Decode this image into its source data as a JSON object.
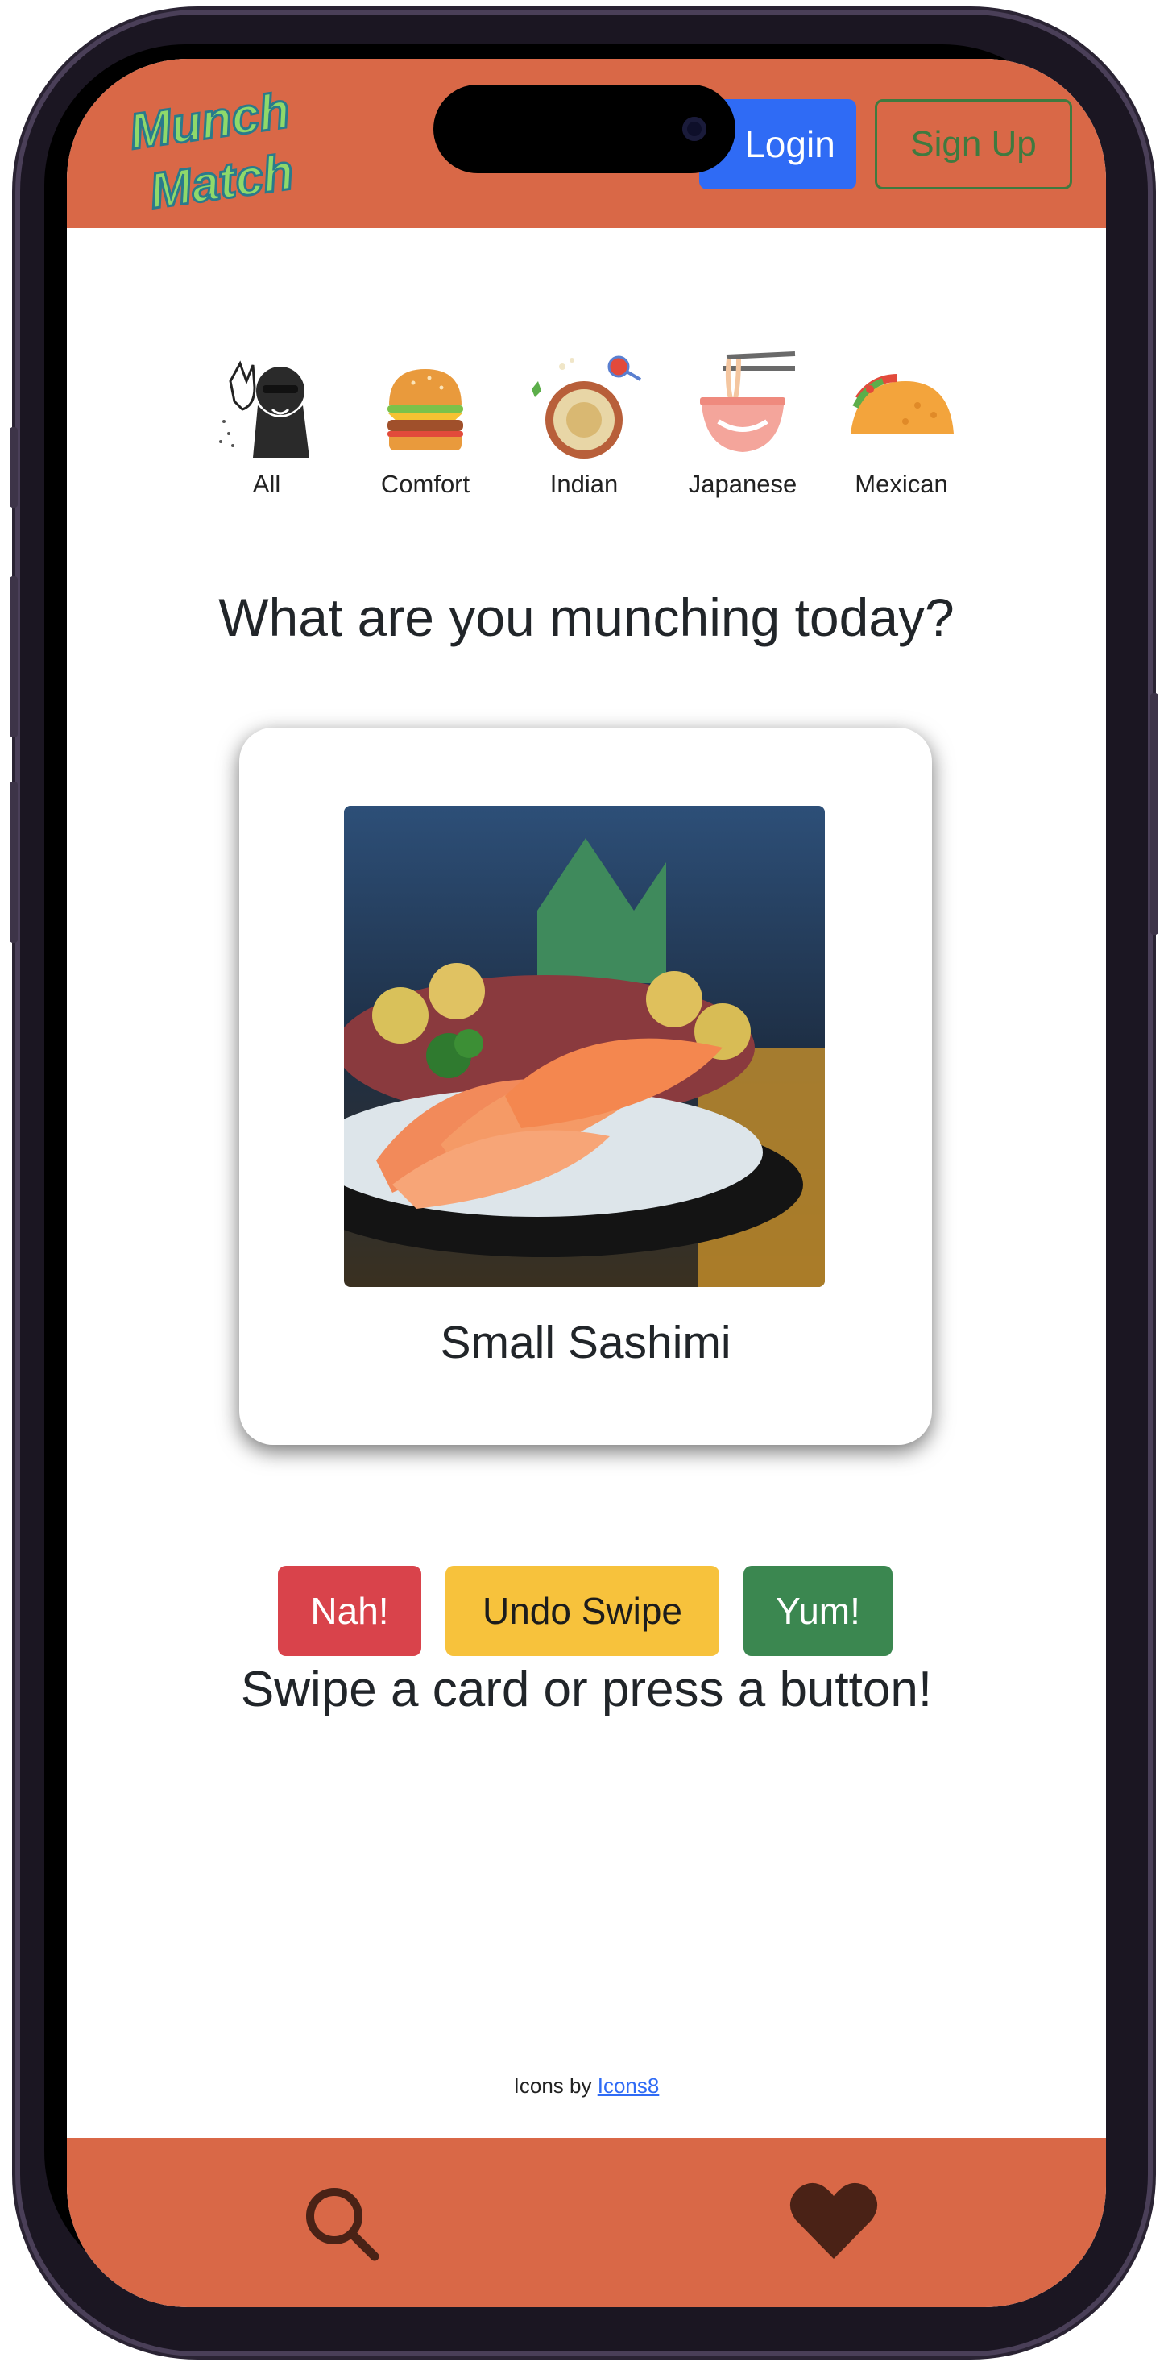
{
  "header": {
    "logo_line1": "Munch",
    "logo_line2": "Match",
    "login_label": "Login",
    "signup_label": "Sign Up"
  },
  "categories": [
    {
      "label": "All",
      "icon": "chef-salt-icon"
    },
    {
      "label": "Comfort",
      "icon": "burger-icon"
    },
    {
      "label": "Indian",
      "icon": "curry-bowl-icon"
    },
    {
      "label": "Japanese",
      "icon": "ramen-bowl-icon"
    },
    {
      "label": "Mexican",
      "icon": "taco-icon"
    }
  ],
  "main": {
    "question": "What are you munching today?",
    "card": {
      "food_name": "Small Sashimi",
      "image_icon": "sashimi-photo"
    },
    "actions": {
      "nah_label": "Nah!",
      "undo_label": "Undo Swipe",
      "yum_label": "Yum!"
    },
    "instruction": "Swipe a card or press a button!"
  },
  "credit": {
    "prefix": "Icons by ",
    "link_text": "Icons8"
  },
  "bottom_nav": {
    "search_icon": "search-icon",
    "favorites_icon": "heart-icon"
  },
  "colors": {
    "brand": "#d96847",
    "login": "#2f6bf5",
    "signup": "#3f7a3f",
    "nah": "#d9434b",
    "undo": "#f7c23c",
    "yum": "#3b8750",
    "nav_icon": "#4a2216"
  }
}
